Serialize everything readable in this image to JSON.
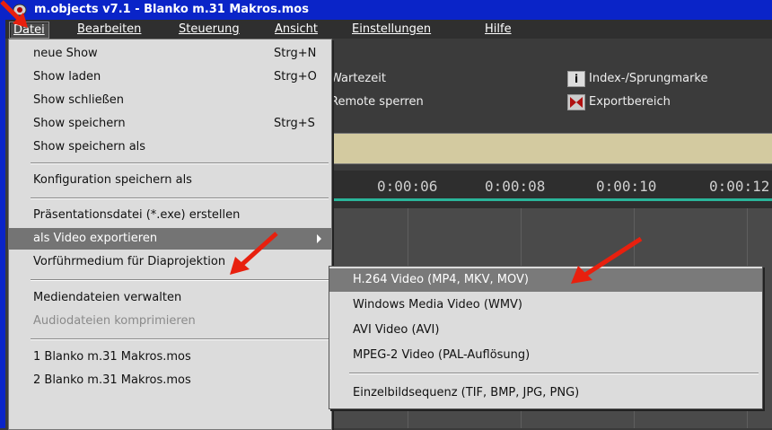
{
  "window": {
    "title": "m.objects v7.1 - Blanko m.31 Makros.mos"
  },
  "menubar": [
    "Datei",
    "Bearbeiten",
    "Steuerung",
    "Ansicht",
    "Einstellungen",
    "Hilfe"
  ],
  "toolbar": {
    "wartezeit": "Wartezeit",
    "remote": "Remote sperren",
    "index": "Index-/Sprungmarke",
    "export": "Exportbereich",
    "i_glyph": "i"
  },
  "ruler": [
    "0:00:06",
    "0:00:08",
    "0:00:10",
    "0:00:12"
  ],
  "datei_menu": {
    "neue_show": "neue Show",
    "neue_show_sc": "Strg+N",
    "show_laden": "Show laden",
    "show_laden_sc": "Strg+O",
    "show_schliessen": "Show schließen",
    "show_speichern": "Show speichern",
    "show_speichern_sc": "Strg+S",
    "show_speichern_als": "Show speichern als",
    "konfig": "Konfiguration speichern als",
    "praesentation": "Präsentationsdatei (*.exe) erstellen",
    "video_export": "als Video exportieren",
    "vorfuehr": "Vorführmedium für Diaprojektion",
    "medien": "Mediendateien verwalten",
    "audio": "Audiodateien komprimieren",
    "recent1": "1 Blanko m.31 Makros.mos",
    "recent2": "2 Blanko m.31 Makros.mos"
  },
  "video_submenu": {
    "h264": "H.264 Video (MP4, MKV, MOV)",
    "wmv": "Windows Media Video (WMV)",
    "avi": "AVI Video (AVI)",
    "mpeg2": "MPEG-2 Video (PAL-Auflösung)",
    "einzelbild": "Einzelbildsequenz (TIF, BMP, JPG, PNG)"
  },
  "colors": {
    "title_bar": "#0a24c8",
    "annotation_arrow": "#e8200e",
    "menu_bg": "#dcdcdc",
    "highlight": "#747474",
    "timeline": "#2ab59a"
  },
  "icons": [
    "app-icon",
    "info-icon",
    "export-range-icon",
    "submenu-arrow-icon",
    "red-annotation-arrow-icon"
  ]
}
